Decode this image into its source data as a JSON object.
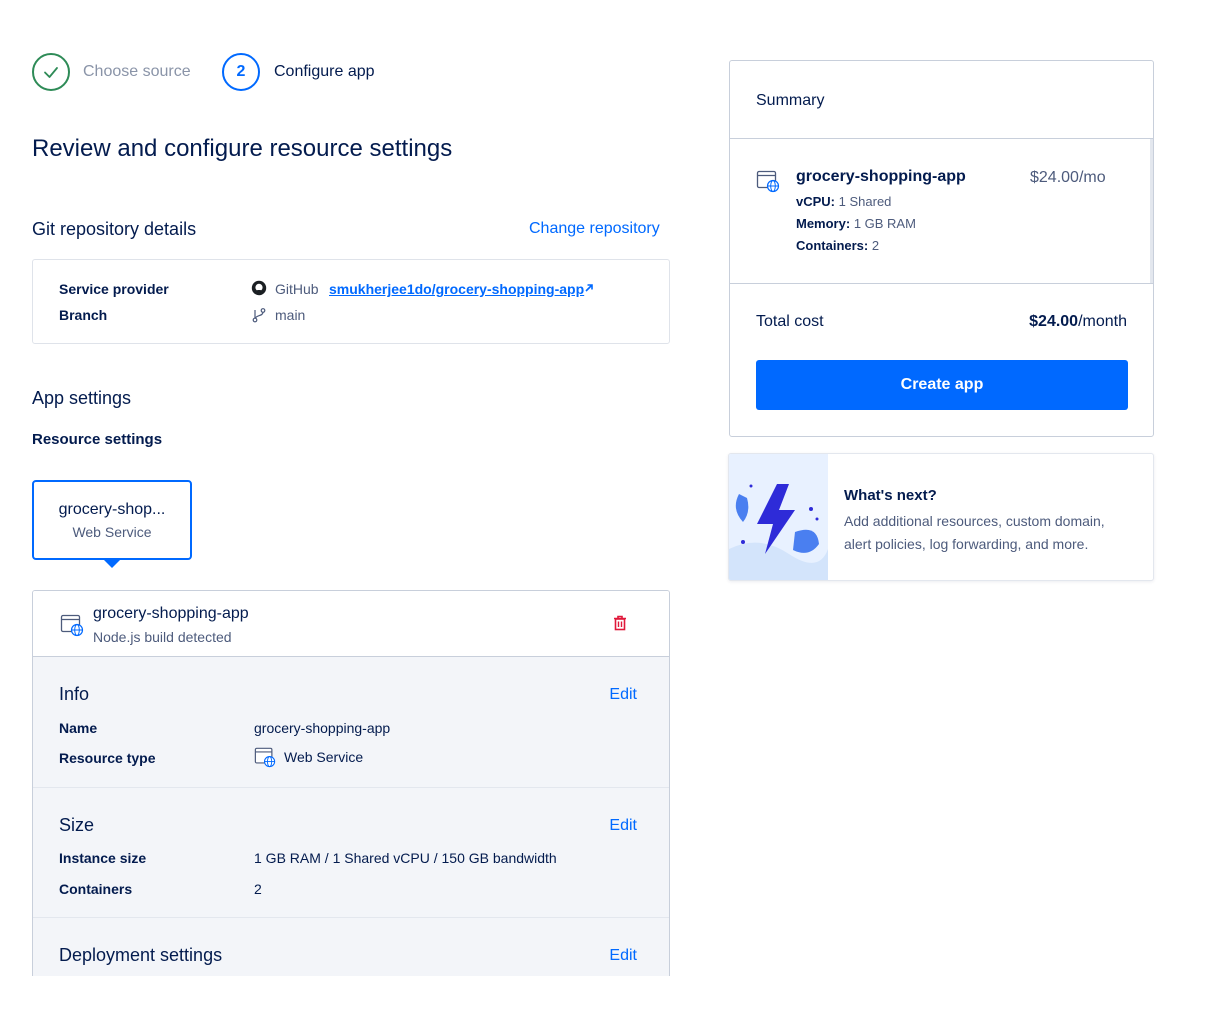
{
  "stepper": {
    "step1_label": "Choose source",
    "step2_number": "2",
    "step2_label": "Configure app"
  },
  "page_title": "Review and configure resource settings",
  "git": {
    "title": "Git repository details",
    "change_link": "Change repository",
    "provider_label": "Service provider",
    "provider_name": "GitHub",
    "repo": "smukherjee1do/grocery-shopping-app",
    "branch_label": "Branch",
    "branch": "main"
  },
  "app_settings": {
    "title": "App settings",
    "resource_settings": "Resource settings"
  },
  "service_tab": {
    "name": "grocery-shop...",
    "type": "Web Service"
  },
  "resource": {
    "name": "grocery-shopping-app",
    "detected": "Node.js build detected",
    "info": {
      "title": "Info",
      "edit": "Edit",
      "name_label": "Name",
      "name_value": "grocery-shopping-app",
      "type_label": "Resource type",
      "type_value": "Web Service"
    },
    "size": {
      "title": "Size",
      "edit": "Edit",
      "instance_label": "Instance size",
      "instance_value": "1 GB RAM / 1 Shared vCPU / 150 GB bandwidth",
      "containers_label": "Containers",
      "containers_value": "2"
    },
    "deployment": {
      "title": "Deployment settings",
      "edit": "Edit"
    }
  },
  "summary": {
    "title": "Summary",
    "item_name": "grocery-shopping-app",
    "item_price": "$24.00/mo",
    "vcpu_label": "vCPU:",
    "vcpu_value": "1 Shared",
    "memory_label": "Memory:",
    "memory_value": "1 GB RAM",
    "containers_label": "Containers:",
    "containers_value": "2",
    "total_label": "Total cost",
    "total_amount": "$24.00",
    "total_period": "/month",
    "create_button": "Create app"
  },
  "whats_next": {
    "title": "What's next?",
    "description": "Add additional resources, custom domain, alert policies, log forwarding, and more."
  },
  "colors": {
    "primary": "#0069ff",
    "success": "#2e8b57",
    "danger": "#e0193a",
    "text": "#031b4e",
    "muted": "#4d5b7c"
  }
}
